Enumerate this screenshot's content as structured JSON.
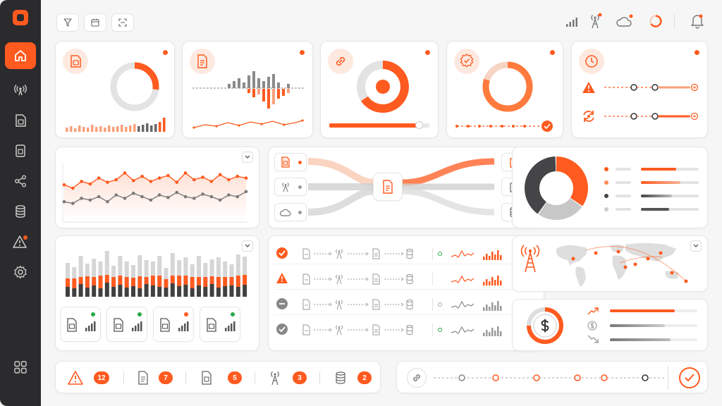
{
  "colors": {
    "accent": "#ff5a1f",
    "accent_light": "#f8a07a",
    "dark": "#2b2b2d",
    "gray": "#9a9a9a",
    "light_gray": "#d9d9d9"
  },
  "sidebar": {
    "items": [
      {
        "icon": "home-icon",
        "active": true
      },
      {
        "icon": "wifi-signal-icon"
      },
      {
        "icon": "sim-card-icon"
      },
      {
        "icon": "chip-card-icon"
      },
      {
        "icon": "share-nodes-icon"
      },
      {
        "icon": "database-icon"
      },
      {
        "icon": "alert-icon"
      },
      {
        "icon": "gear-icon"
      }
    ],
    "bottom_icon": "grid-apps-icon"
  },
  "toolbar": {
    "left": [
      "filter-icon",
      "calendar-icon",
      "scan-icon"
    ],
    "right": [
      "signal-bars-icon",
      "antenna-icon",
      "cloud-icon",
      "loading-ring-icon",
      "bell-icon"
    ]
  },
  "kpi_cards": [
    {
      "icon": "sim-card-icon",
      "donut_fraction": 0.27
    },
    {
      "icon": "document-icon"
    },
    {
      "icon": "link-icon"
    },
    {
      "icon": "badge-check-icon",
      "ring_fraction": 0.8
    },
    {
      "icon": "clock-icon"
    }
  ],
  "line_chart": {
    "orange": [
      44,
      40,
      48,
      45,
      52,
      47,
      50,
      58,
      49,
      54,
      48,
      52,
      55,
      47,
      58,
      50,
      53,
      48,
      56,
      50,
      54,
      52
    ],
    "gray": [
      24,
      22,
      28,
      26,
      30,
      24,
      32,
      28,
      34,
      30,
      26,
      32,
      29,
      35,
      30,
      28,
      33,
      30,
      26,
      32,
      30,
      36
    ]
  },
  "stacked_bars": {
    "dark": [
      14,
      12,
      18,
      13,
      16,
      12,
      20,
      14,
      17,
      13,
      15,
      12,
      18,
      16,
      14,
      13,
      19,
      15,
      17,
      12,
      16,
      14,
      18,
      13,
      15,
      16,
      14,
      17
    ],
    "orange": [
      12,
      14,
      10,
      16,
      12,
      18,
      11,
      14,
      13,
      15,
      12,
      17,
      10,
      14,
      16,
      12,
      11,
      15,
      13,
      16,
      12,
      14,
      11,
      15,
      13,
      12,
      16,
      14
    ],
    "gray": [
      22,
      16,
      30,
      18,
      26,
      20,
      34,
      16,
      28,
      22,
      18,
      30,
      24,
      20,
      28,
      16,
      32,
      22,
      26,
      18,
      30,
      20,
      24,
      28,
      22,
      18,
      30,
      26
    ]
  },
  "device_tiles": [
    {
      "status": "green"
    },
    {
      "status": "green"
    },
    {
      "status": "orange"
    },
    {
      "status": "green"
    }
  ],
  "summary": {
    "alerts_count": "12",
    "documents_count": "7",
    "sim_count": "5",
    "towers_count": "3",
    "databases_count": "2"
  },
  "donut": {
    "values": [
      35,
      25,
      40
    ]
  }
}
